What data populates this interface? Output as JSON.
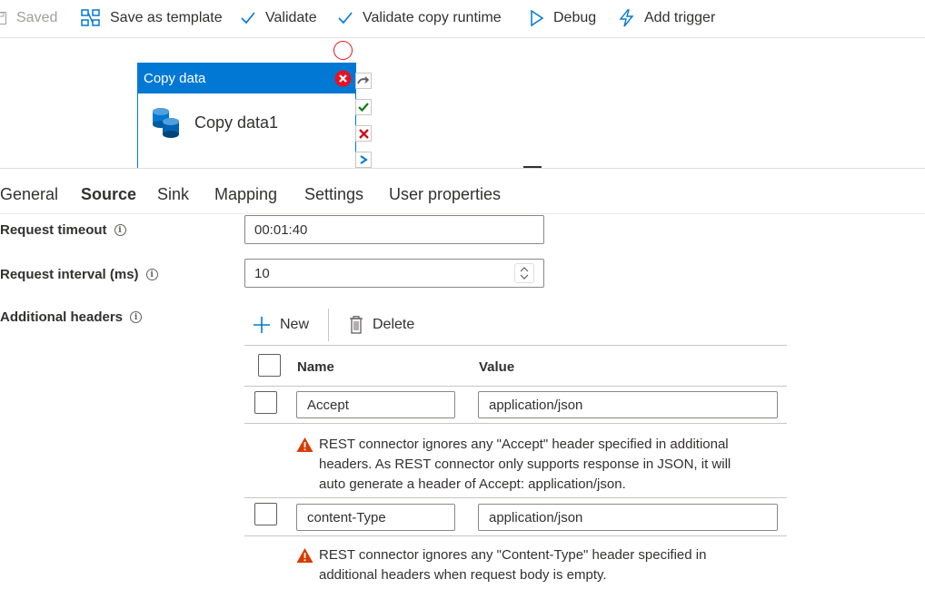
{
  "toolbar": {
    "saved_label": "Saved",
    "save_template_label": "Save as template",
    "validate_label": "Validate",
    "validate_runtime_label": "Validate copy runtime",
    "debug_label": "Debug",
    "add_trigger_label": "Add trigger"
  },
  "canvas": {
    "activity": {
      "type_label": "Copy data",
      "name": "Copy data1"
    }
  },
  "tabs": [
    {
      "label": "General"
    },
    {
      "label": "Source"
    },
    {
      "label": "Sink"
    },
    {
      "label": "Mapping"
    },
    {
      "label": "Settings"
    },
    {
      "label": "User properties"
    }
  ],
  "active_tab": "Source",
  "form": {
    "request_timeout": {
      "label": "Request timeout",
      "value": "00:01:40"
    },
    "request_interval": {
      "label": "Request interval (ms)",
      "value": "10"
    },
    "additional_headers": {
      "label": "Additional headers",
      "new_label": "New",
      "delete_label": "Delete",
      "columns": {
        "name": "Name",
        "value": "Value"
      },
      "rows": [
        {
          "name": "Accept",
          "value": "application/json",
          "warning_lines": [
            "REST connector ignores any \"Accept\" header specified in additional",
            "headers. As REST connector only supports response in JSON, it will",
            "auto generate a header of Accept: application/json."
          ]
        },
        {
          "name": "content-Type",
          "value": "application/json",
          "warning_lines": [
            "REST connector ignores any \"Content-Type\" header specified in",
            "additional headers when request body is empty."
          ]
        }
      ]
    }
  },
  "colors": {
    "accent": "#0078d4",
    "error": "#e81123",
    "success": "#107c10",
    "warning": "#d83b01"
  }
}
